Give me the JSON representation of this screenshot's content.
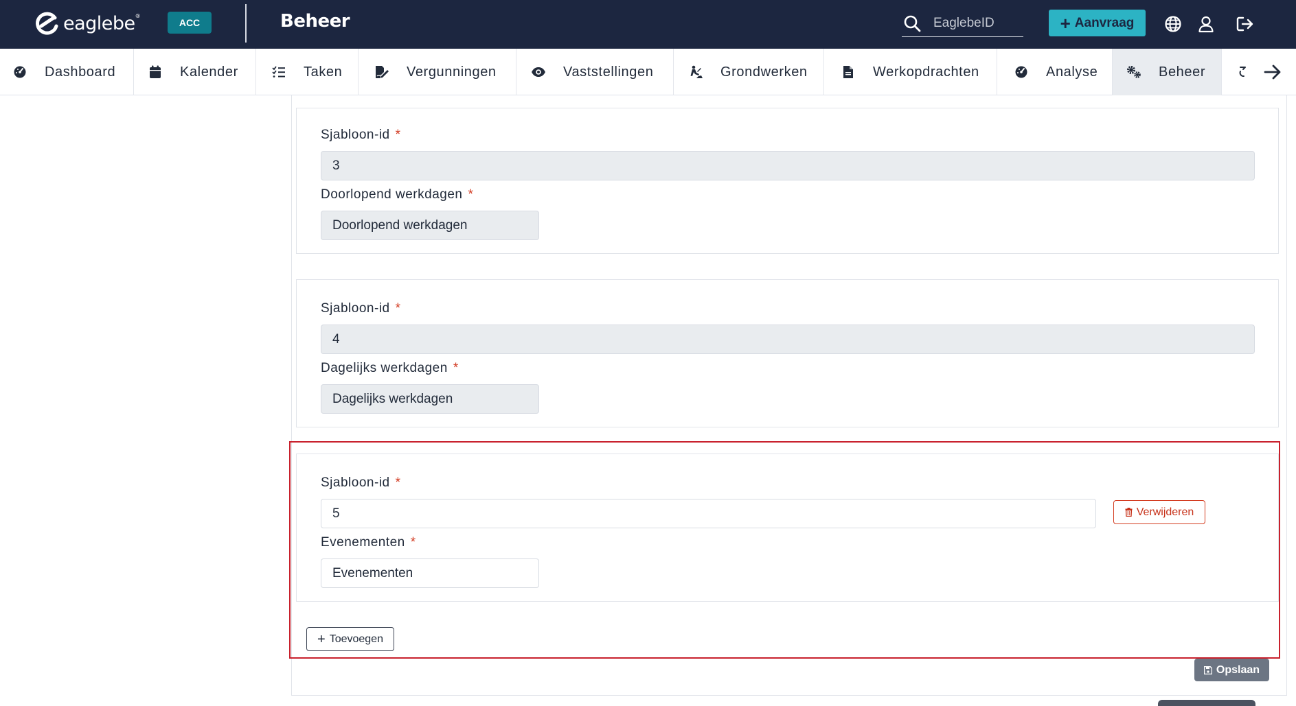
{
  "header": {
    "logo_text": "eaglebe",
    "logo_reg": "®",
    "env_badge": "ACC",
    "page_title": "Beheer",
    "search_placeholder": "EaglebeID",
    "new_request_label": "Aanvraag",
    "icons": [
      "search-icon",
      "plus-icon",
      "globe-icon",
      "user-icon",
      "logout-icon"
    ],
    "colors": {
      "topbar": "#1c2640",
      "accent": "#2cb3c4",
      "env_badge": "#0f7c8c"
    }
  },
  "nav": {
    "items": [
      {
        "label": "Dashboard",
        "icon": "dashboard-icon"
      },
      {
        "label": "Kalender",
        "icon": "calendar-icon"
      },
      {
        "label": "Taken",
        "icon": "task-list-icon"
      },
      {
        "label": "Vergunningen",
        "icon": "permit-icon"
      },
      {
        "label": "Vaststellingen",
        "icon": "eye-icon"
      },
      {
        "label": "Grondwerken",
        "icon": "digging-icon"
      },
      {
        "label": "Werkopdrachten",
        "icon": "document-icon"
      },
      {
        "label": "Analyse",
        "icon": "dashboard-icon"
      },
      {
        "label": "Beheer",
        "icon": "gears-icon",
        "active": true
      }
    ],
    "next_icon": "arrow-right-icon"
  },
  "form": {
    "cards": [
      {
        "id_label": "Sjabloon-id",
        "id_value": "3",
        "name_label": "Doorlopend werkdagen",
        "name_value": "Doorlopend werkdagen",
        "editable": false
      },
      {
        "id_label": "Sjabloon-id",
        "id_value": "4",
        "name_label": "Dagelijks werkdagen",
        "name_value": "Dagelijks werkdagen",
        "editable": false
      },
      {
        "id_label": "Sjabloon-id",
        "id_value": "5",
        "name_label": "Evenementen",
        "name_value": "Evenementen",
        "editable": true,
        "delete_label": "Verwijderen"
      }
    ],
    "required_marker": "*",
    "add_label": "Toevoegen",
    "save_label": "Opslaan",
    "colors": {
      "required": "#d23b22",
      "delete": "#c7321a",
      "highlight": "#c8202c",
      "save": "#6c7583"
    }
  }
}
